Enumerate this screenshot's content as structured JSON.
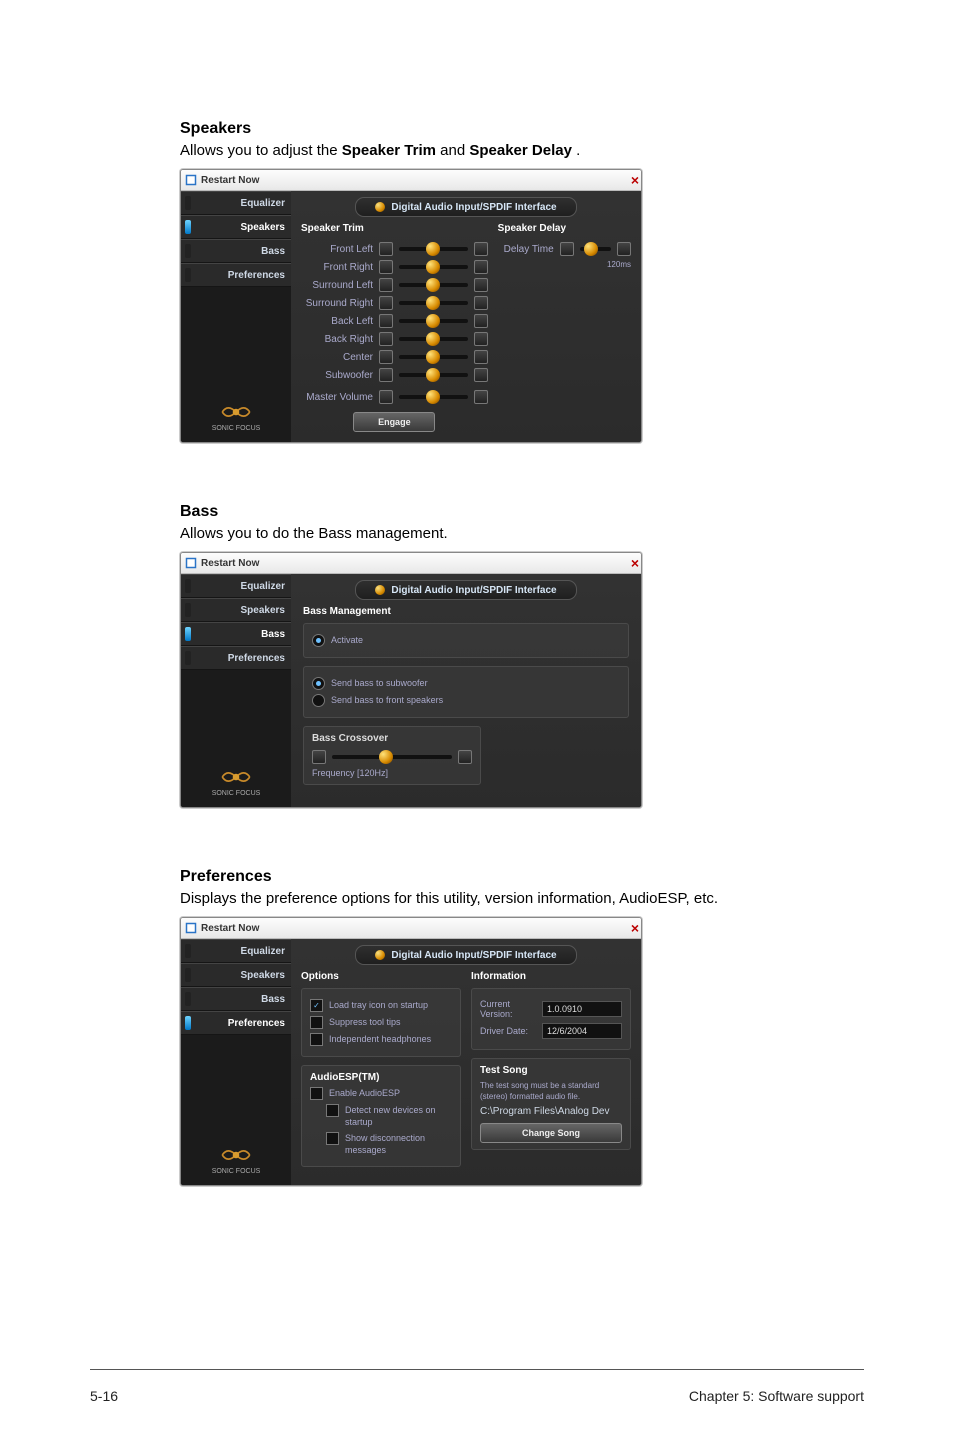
{
  "sections": {
    "speakers": {
      "heading": "Speakers",
      "desc_before": "Allows you to adjust the ",
      "bold1": "Speaker Trim",
      "mid": " and ",
      "bold2": "Speaker Delay",
      "desc_after": "."
    },
    "bass": {
      "heading": "Bass",
      "desc": "Allows you to do the Bass management."
    },
    "prefs": {
      "heading": "Preferences",
      "desc": "Displays the preference options for this utility, version information, AudioESP, etc."
    }
  },
  "window": {
    "title": "Restart Now",
    "close_label": "×",
    "pill": "Digital Audio Input/SPDIF Interface",
    "logo_caption": "SONIC FOCUS"
  },
  "tabs": {
    "equalizer": "Equalizer",
    "speakers": "Speakers",
    "bass": "Bass",
    "preferences": "Preferences"
  },
  "speakers": {
    "left_title": "Speaker Trim",
    "right_title": "Speaker Delay",
    "sliders": [
      "Front Left",
      "Front Right",
      "Surround Left",
      "Surround Right",
      "Back Left",
      "Back Right",
      "Center",
      "Subwoofer"
    ],
    "master": "Master Volume",
    "master_btn": "Engage",
    "delay_label": "Delay Time",
    "delay_unit": "120ms"
  },
  "bass": {
    "title": "Bass Management",
    "activate": "Activate",
    "opt1": "Send bass to subwoofer",
    "opt2": "Send bass to front speakers",
    "xover": "Bass Crossover",
    "freq": "Frequency  [120Hz]"
  },
  "prefs": {
    "left_title": "Options",
    "opt1": "Load tray icon on startup",
    "opt2": "Suppress tool tips",
    "opt3": "Independent headphones",
    "esp_title": "AudioESP(TM)",
    "esp1": "Enable AudioESP",
    "esp2": "Detect new devices on startup",
    "esp3": "Show disconnection messages",
    "info_title": "Information",
    "info_ver_k": "Current Version:",
    "info_ver_v": "1.0.0910",
    "info_drv_k": "Driver Date:",
    "info_drv_v": "12/6/2004",
    "test_title": "Test Song",
    "test_desc": "The test song must be a standard (stereo) formatted audio file.",
    "test_path": "C:\\Program Files\\Analog Dev",
    "test_btn": "Change Song"
  },
  "footer": {
    "left": "5-16",
    "right": "Chapter 5: Software support"
  }
}
